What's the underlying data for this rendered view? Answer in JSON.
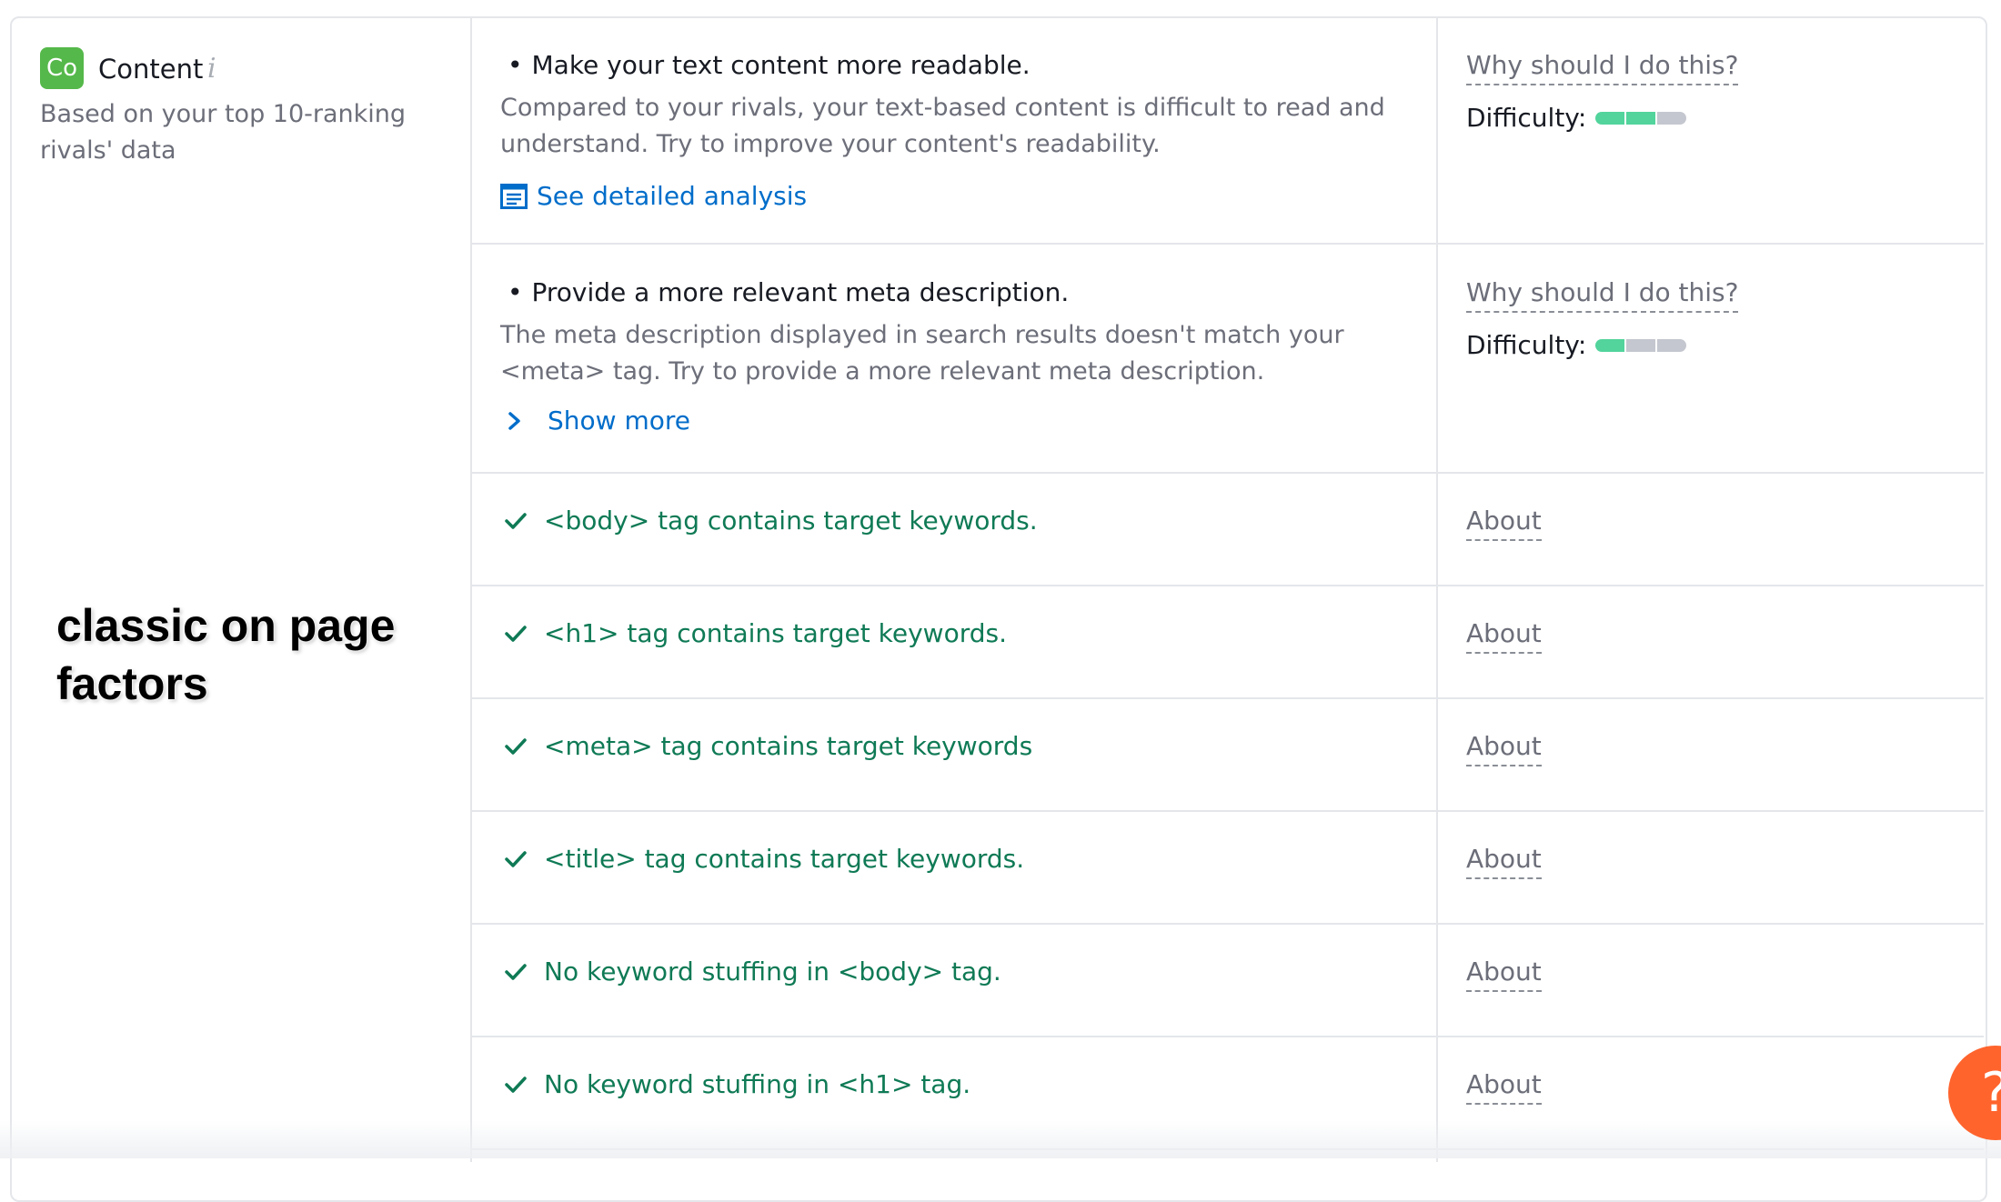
{
  "category": {
    "badge": "Co",
    "title": "Content",
    "info_icon": "i",
    "subtitle": "Based on your top 10-ranking rivals' data"
  },
  "overlay_text": "classic on page factors",
  "recommendations": [
    {
      "title": "Make your text content more readable.",
      "description": "Compared to your rivals, your text-based content is difficult to read and understand. Try to improve your content's readability.",
      "link": "See detailed analysis",
      "link_icon": "document-icon",
      "why": "Why should I do this?",
      "difficulty_label": "Difficulty:",
      "difficulty_level": 2,
      "difficulty_max": 3
    },
    {
      "title": "Provide a more relevant meta description.",
      "description": "The meta description displayed in search results doesn't match your <meta> tag. Try to provide a more relevant meta description.",
      "link": "Show more",
      "link_icon": "chevron-right-icon",
      "why": "Why should I do this?",
      "difficulty_label": "Difficulty:",
      "difficulty_level": 1,
      "difficulty_max": 3
    }
  ],
  "checks": [
    {
      "text": "<body> tag contains target keywords.",
      "about": "About"
    },
    {
      "text": "<h1> tag contains target keywords.",
      "about": "About"
    },
    {
      "text": "<meta> tag contains target keywords",
      "about": "About"
    },
    {
      "text": "<title> tag contains target keywords.",
      "about": "About"
    },
    {
      "text": "No keyword stuffing in <body> tag.",
      "about": "About"
    },
    {
      "text": "No keyword stuffing in <h1> tag.",
      "about": "About"
    }
  ],
  "help_button": "?",
  "colors": {
    "badge_green": "#55b84a",
    "link_blue": "#006dca",
    "check_green": "#0f7a55",
    "difficulty_on": "#52d49c",
    "difficulty_off": "#c4c7cf",
    "help_orange": "#ff642d"
  }
}
